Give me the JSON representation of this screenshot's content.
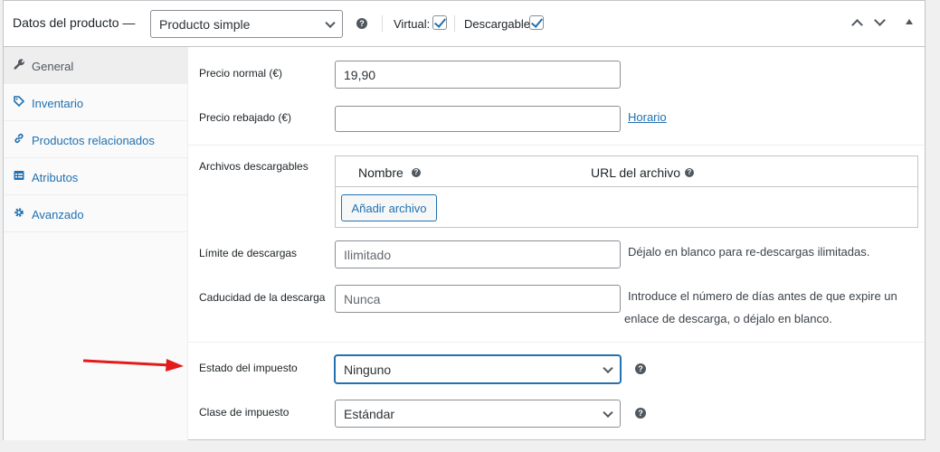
{
  "header": {
    "title": "Datos del producto —",
    "product_type": "Producto simple",
    "virtual_label": "Virtual:",
    "virtual_checked": true,
    "downloadable_label": "Descargable:",
    "downloadable_checked": true
  },
  "sidebar": {
    "items": [
      {
        "label": "General",
        "icon": "wrench-icon",
        "active": true
      },
      {
        "label": "Inventario",
        "icon": "tag-icon",
        "active": false
      },
      {
        "label": "Productos relacionados",
        "icon": "link-icon",
        "active": false
      },
      {
        "label": "Atributos",
        "icon": "table-icon",
        "active": false
      },
      {
        "label": "Avanzado",
        "icon": "gear-icon",
        "active": false
      }
    ]
  },
  "pricing": {
    "regular_label": "Precio normal (€)",
    "regular_value": "19,90",
    "sale_label": "Precio rebajado (€)",
    "sale_value": "",
    "schedule_link": "Horario"
  },
  "downloads": {
    "files_label": "Archivos descargables",
    "col_name": "Nombre",
    "col_url": "URL del archivo",
    "add_file_button": "Añadir archivo",
    "limit_label": "Límite de descargas",
    "limit_placeholder": "Ilimitado",
    "limit_desc": "Déjalo en blanco para re-descargas ilimitadas.",
    "expiry_label": "Caducidad de la descarga",
    "expiry_placeholder": "Nunca",
    "expiry_desc_line1": "Introduce el número de días antes de que expire un",
    "expiry_desc_line2": "enlace de descarga, o déjalo en blanco."
  },
  "tax": {
    "status_label": "Estado del impuesto",
    "status_value": "Ninguno",
    "class_label": "Clase de impuesto",
    "class_value": "Estándar"
  },
  "colors": {
    "accent": "#2271b1",
    "arrow": "#e31b1b"
  }
}
